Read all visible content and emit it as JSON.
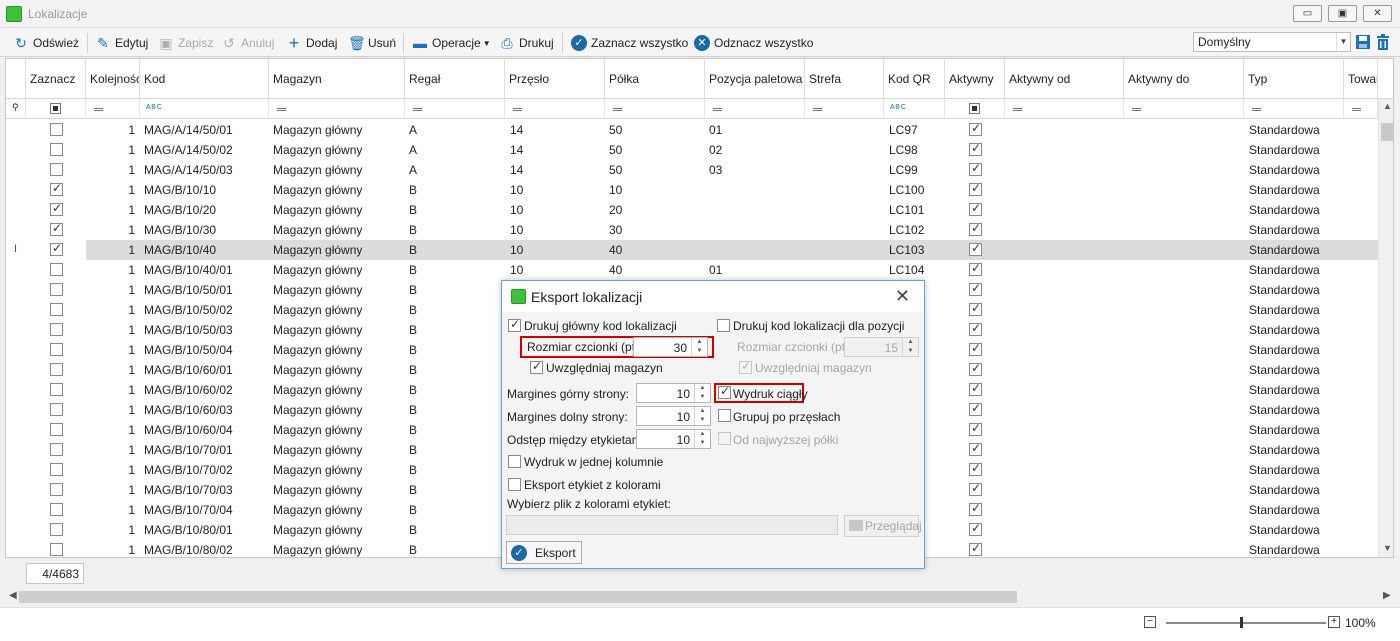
{
  "window": {
    "title": "Lokalizacje",
    "min_label": "▭",
    "max_label": "▣",
    "close_label": "✕"
  },
  "toolbar": {
    "refresh": "Odśwież",
    "edit": "Edytuj",
    "save": "Zapisz",
    "cancel": "Anuluj",
    "add": "Dodaj",
    "delete": "Usuń",
    "operations": "Operacje",
    "print": "Drukuj",
    "select_all": "Zaznacz wszystko",
    "deselect_all": "Odznacz wszystko",
    "layout_value": "Domyślny"
  },
  "grid": {
    "columns": [
      "Zaznacz",
      "Kolejność",
      "Kod",
      "Magazyn",
      "Regał",
      "Przęsło",
      "Półka",
      "Pozycja paletowa",
      "Strefa",
      "Kod QR",
      "Aktywny",
      "Aktywny od",
      "Aktywny do",
      "Typ",
      "Towar"
    ],
    "rows": [
      {
        "checked": false,
        "order": "1",
        "code": "MAG/A/14/50/01",
        "warehouse": "Magazyn główny",
        "rack": "A",
        "span": "14",
        "shelf": "50",
        "pallet": "01",
        "qr": "LC97",
        "active": true,
        "type": "Standardowa"
      },
      {
        "checked": false,
        "order": "1",
        "code": "MAG/A/14/50/02",
        "warehouse": "Magazyn główny",
        "rack": "A",
        "span": "14",
        "shelf": "50",
        "pallet": "02",
        "qr": "LC98",
        "active": true,
        "type": "Standardowa"
      },
      {
        "checked": false,
        "order": "1",
        "code": "MAG/A/14/50/03",
        "warehouse": "Magazyn główny",
        "rack": "A",
        "span": "14",
        "shelf": "50",
        "pallet": "03",
        "qr": "LC99",
        "active": true,
        "type": "Standardowa"
      },
      {
        "checked": true,
        "order": "1",
        "code": "MAG/B/10/10",
        "warehouse": "Magazyn główny",
        "rack": "B",
        "span": "10",
        "shelf": "10",
        "pallet": "",
        "qr": "LC100",
        "active": true,
        "type": "Standardowa"
      },
      {
        "checked": true,
        "order": "1",
        "code": "MAG/B/10/20",
        "warehouse": "Magazyn główny",
        "rack": "B",
        "span": "10",
        "shelf": "20",
        "pallet": "",
        "qr": "LC101",
        "active": true,
        "type": "Standardowa"
      },
      {
        "checked": true,
        "order": "1",
        "code": "MAG/B/10/30",
        "warehouse": "Magazyn główny",
        "rack": "B",
        "span": "10",
        "shelf": "30",
        "pallet": "",
        "qr": "LC102",
        "active": true,
        "type": "Standardowa"
      },
      {
        "checked": true,
        "order": "1",
        "code": "MAG/B/10/40",
        "warehouse": "Magazyn główny",
        "rack": "B",
        "span": "10",
        "shelf": "40",
        "pallet": "",
        "qr": "LC103",
        "active": true,
        "type": "Standardowa",
        "selected": true
      },
      {
        "checked": false,
        "order": "1",
        "code": "MAG/B/10/40/01",
        "warehouse": "Magazyn główny",
        "rack": "B",
        "span": "10",
        "shelf": "40",
        "pallet": "01",
        "qr": "LC104",
        "active": true,
        "type": "Standardowa"
      },
      {
        "checked": false,
        "order": "1",
        "code": "MAG/B/10/50/01",
        "warehouse": "Magazyn główny",
        "rack": "B",
        "span": "",
        "shelf": "",
        "pallet": "",
        "qr": "",
        "active": true,
        "type": "Standardowa"
      },
      {
        "checked": false,
        "order": "1",
        "code": "MAG/B/10/50/02",
        "warehouse": "Magazyn główny",
        "rack": "B",
        "span": "",
        "shelf": "",
        "pallet": "",
        "qr": "",
        "active": true,
        "type": "Standardowa"
      },
      {
        "checked": false,
        "order": "1",
        "code": "MAG/B/10/50/03",
        "warehouse": "Magazyn główny",
        "rack": "B",
        "span": "",
        "shelf": "",
        "pallet": "",
        "qr": "",
        "active": true,
        "type": "Standardowa"
      },
      {
        "checked": false,
        "order": "1",
        "code": "MAG/B/10/50/04",
        "warehouse": "Magazyn główny",
        "rack": "B",
        "span": "",
        "shelf": "",
        "pallet": "",
        "qr": "",
        "active": true,
        "type": "Standardowa"
      },
      {
        "checked": false,
        "order": "1",
        "code": "MAG/B/10/60/01",
        "warehouse": "Magazyn główny",
        "rack": "B",
        "span": "",
        "shelf": "",
        "pallet": "",
        "qr": "",
        "active": true,
        "type": "Standardowa"
      },
      {
        "checked": false,
        "order": "1",
        "code": "MAG/B/10/60/02",
        "warehouse": "Magazyn główny",
        "rack": "B",
        "span": "",
        "shelf": "",
        "pallet": "",
        "qr": "",
        "active": true,
        "type": "Standardowa"
      },
      {
        "checked": false,
        "order": "1",
        "code": "MAG/B/10/60/03",
        "warehouse": "Magazyn główny",
        "rack": "B",
        "span": "",
        "shelf": "",
        "pallet": "",
        "qr": "",
        "active": true,
        "type": "Standardowa"
      },
      {
        "checked": false,
        "order": "1",
        "code": "MAG/B/10/60/04",
        "warehouse": "Magazyn główny",
        "rack": "B",
        "span": "",
        "shelf": "",
        "pallet": "",
        "qr": "",
        "active": true,
        "type": "Standardowa"
      },
      {
        "checked": false,
        "order": "1",
        "code": "MAG/B/10/70/01",
        "warehouse": "Magazyn główny",
        "rack": "B",
        "span": "",
        "shelf": "",
        "pallet": "",
        "qr": "",
        "active": true,
        "type": "Standardowa"
      },
      {
        "checked": false,
        "order": "1",
        "code": "MAG/B/10/70/02",
        "warehouse": "Magazyn główny",
        "rack": "B",
        "span": "",
        "shelf": "",
        "pallet": "",
        "qr": "",
        "active": true,
        "type": "Standardowa"
      },
      {
        "checked": false,
        "order": "1",
        "code": "MAG/B/10/70/03",
        "warehouse": "Magazyn główny",
        "rack": "B",
        "span": "",
        "shelf": "",
        "pallet": "",
        "qr": "",
        "active": true,
        "type": "Standardowa"
      },
      {
        "checked": false,
        "order": "1",
        "code": "MAG/B/10/70/04",
        "warehouse": "Magazyn główny",
        "rack": "B",
        "span": "",
        "shelf": "",
        "pallet": "",
        "qr": "",
        "active": true,
        "type": "Standardowa"
      },
      {
        "checked": false,
        "order": "1",
        "code": "MAG/B/10/80/01",
        "warehouse": "Magazyn główny",
        "rack": "B",
        "span": "",
        "shelf": "",
        "pallet": "",
        "qr": "",
        "active": true,
        "type": "Standardowa"
      },
      {
        "checked": false,
        "order": "1",
        "code": "MAG/B/10/80/02",
        "warehouse": "Magazyn główny",
        "rack": "B",
        "span": "",
        "shelf": "",
        "pallet": "",
        "qr": "",
        "active": true,
        "type": "Standardowa"
      }
    ],
    "record_counter": "4/4683",
    "row_indicator": "I"
  },
  "zoom": {
    "value": "100%"
  },
  "dialog": {
    "title": "Eksport lokalizacji",
    "print_main_code": {
      "label": "Drukuj główny kod lokalizacji",
      "checked": true
    },
    "font_size_main": {
      "label": "Rozmiar czcionki (pt):",
      "value": "30"
    },
    "include_warehouse_main": {
      "label": "Uwzględniaj magazyn",
      "checked": true
    },
    "print_position_code": {
      "label": "Drukuj kod lokalizacji dla pozycji",
      "checked": false
    },
    "font_size_position": {
      "label": "Rozmiar czcionki (pt):",
      "value": "15"
    },
    "include_warehouse_position": {
      "label": "Uwzględniaj magazyn",
      "checked": true
    },
    "margin_top": {
      "label": "Margines górny strony:",
      "value": "10"
    },
    "margin_bottom": {
      "label": "Margines dolny strony:",
      "value": "10"
    },
    "label_spacing": {
      "label": "Odstęp między etykietami:",
      "value": "10"
    },
    "continuous_print": {
      "label": "Wydruk ciągły",
      "checked": true
    },
    "group_by_span": {
      "label": "Grupuj po przęsłach",
      "checked": false
    },
    "from_top_shelf": {
      "label": "Od najwyższej półki",
      "checked": false
    },
    "single_column": {
      "label": "Wydruk w jednej kolumnie",
      "checked": false
    },
    "color_labels": {
      "label": "Eksport etykiet z kolorami",
      "checked": false
    },
    "color_file_label": "Wybierz plik z kolorami etykiet:",
    "color_file_path": "",
    "browse": "Przeglądaj",
    "export": "Eksport"
  }
}
